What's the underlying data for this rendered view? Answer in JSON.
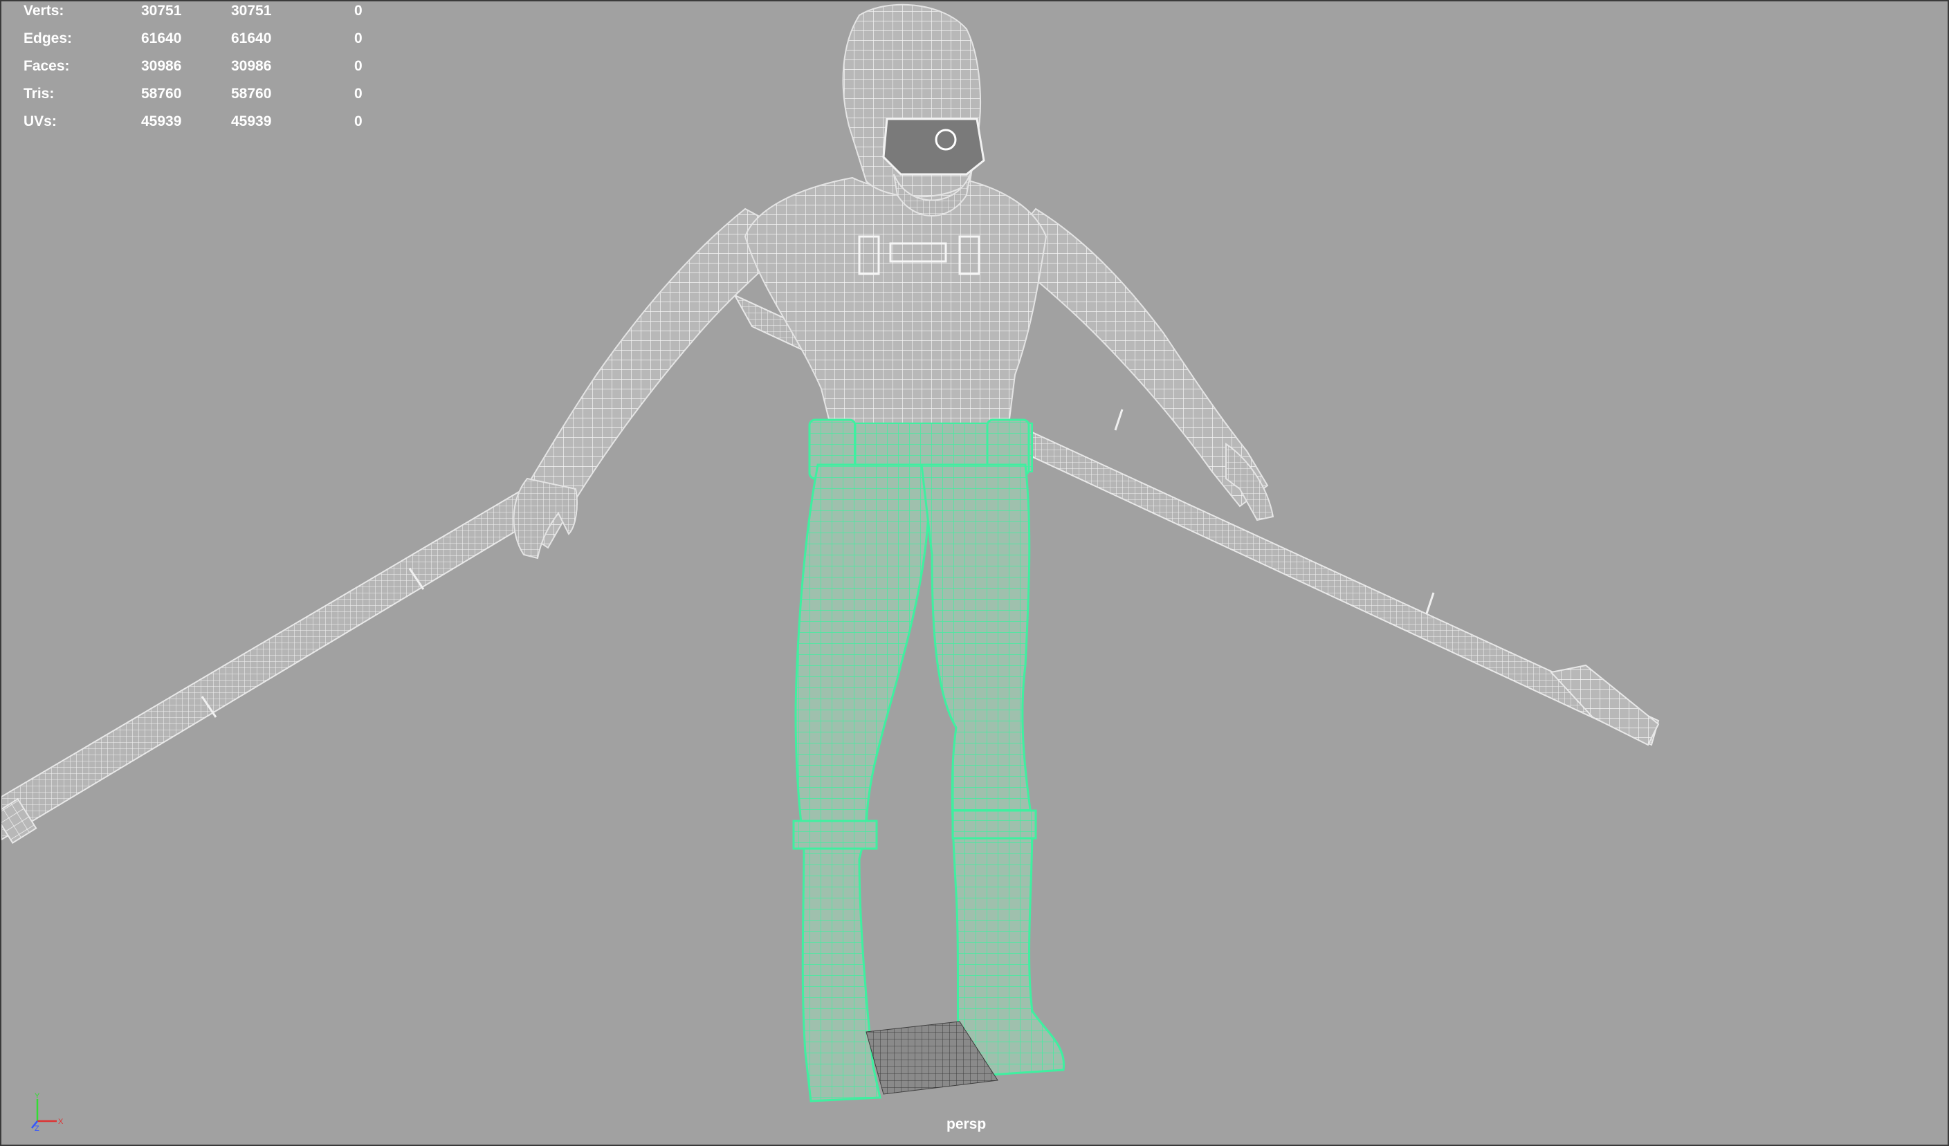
{
  "heads_up_display": {
    "rows": [
      {
        "label": "Verts:",
        "v1": "30751",
        "v2": "30751",
        "v3": "0"
      },
      {
        "label": "Edges:",
        "v1": "61640",
        "v2": "61640",
        "v3": "0"
      },
      {
        "label": "Faces:",
        "v1": "30986",
        "v2": "30986",
        "v3": "0"
      },
      {
        "label": "Tris:",
        "v1": "58760",
        "v2": "58760",
        "v3": "0"
      },
      {
        "label": "UVs:",
        "v1": "45939",
        "v2": "45939",
        "v3": "0"
      }
    ]
  },
  "viewport": {
    "camera_label": "persp",
    "background_color": "#a1a1a1",
    "wireframe_color": "#ffffff",
    "selection_color": "#33ee99"
  },
  "axis_gizmo": {
    "y_label": "Y",
    "x_label": "X",
    "z_label": "Z",
    "y_color": "#33dd33",
    "x_color": "#dd3333",
    "z_color": "#3355ff"
  }
}
